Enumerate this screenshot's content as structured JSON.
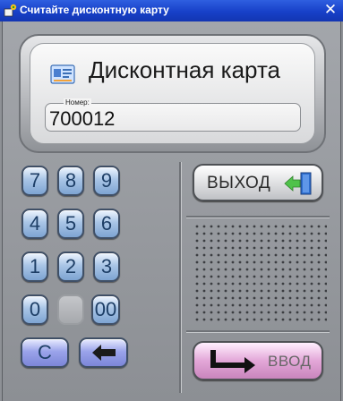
{
  "window": {
    "title": "Считайте дисконтную карту",
    "close_symbol": "✕",
    "icon": "app-icon",
    "titlebar_color": "#1a44cf"
  },
  "card": {
    "title": "Дисконтная карта",
    "icon": "card-icon",
    "number_label": "Номер:",
    "number_value": "700012"
  },
  "keypad": {
    "keys": [
      "7",
      "8",
      "9",
      "4",
      "5",
      "6",
      "1",
      "2",
      "3",
      "0",
      "",
      "00"
    ],
    "clear_label": "C",
    "backspace_icon": "backspace-arrow-icon",
    "key_color": "#a9c5e6"
  },
  "exit_button": {
    "label": "ВЫХОД",
    "icon": "exit-door-icon"
  },
  "enter_button": {
    "label": "ВВОД",
    "icon": "enter-arrow-icon",
    "color": "#e3a7d8"
  },
  "speaker": {
    "icon": "speaker-grille"
  }
}
